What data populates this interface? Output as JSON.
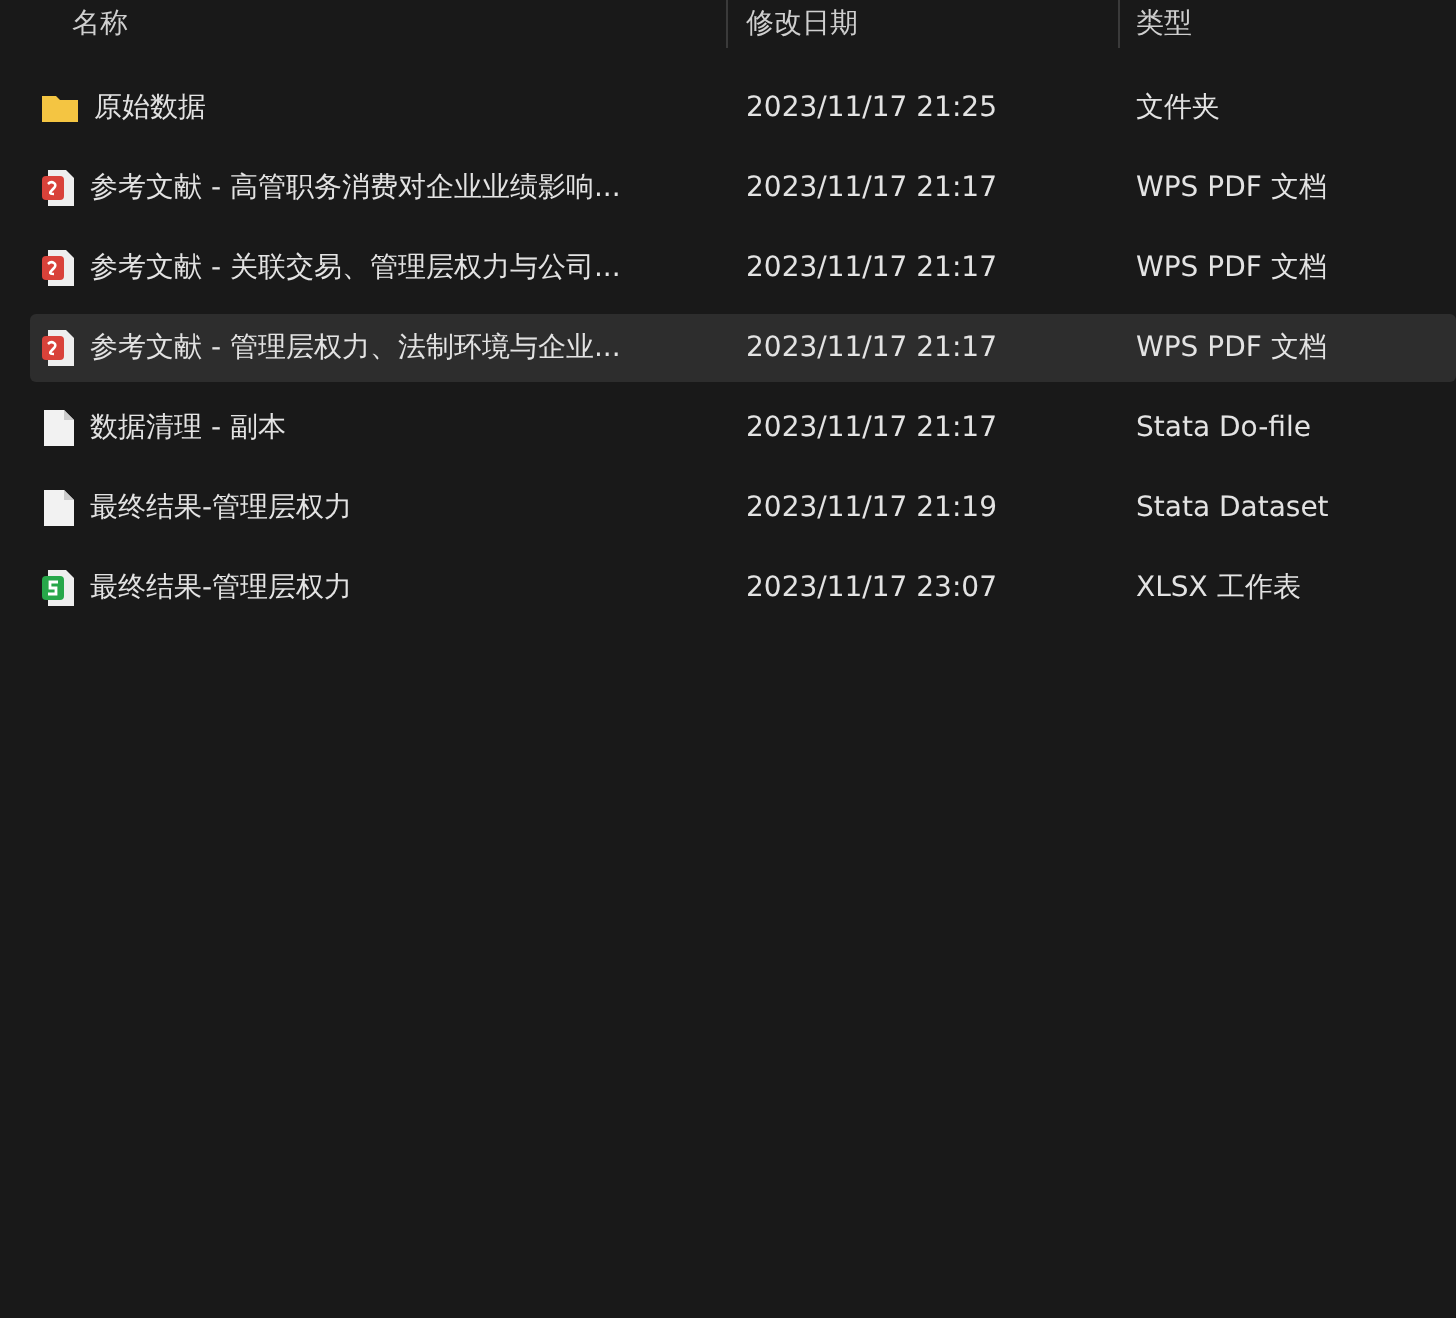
{
  "columns": [
    "名称",
    "修改日期",
    "类型"
  ],
  "rows": [
    {
      "kind": "folder",
      "name": "原始数据",
      "date": "2023/11/17 21:25",
      "type": "文件夹",
      "selected": false
    },
    {
      "kind": "pdf",
      "name": "参考文献 - 高管职务消费对企业业绩影响...",
      "date": "2023/11/17 21:17",
      "type": "WPS PDF 文档",
      "selected": false
    },
    {
      "kind": "pdf",
      "name": "参考文献 - 关联交易、管理层权力与公司...",
      "date": "2023/11/17 21:17",
      "type": "WPS PDF 文档",
      "selected": false
    },
    {
      "kind": "pdf",
      "name": "参考文献 - 管理层权力、法制环境与企业...",
      "date": "2023/11/17 21:17",
      "type": "WPS PDF 文档",
      "selected": true
    },
    {
      "kind": "file",
      "name": "数据清理 - 副本",
      "date": "2023/11/17 21:17",
      "type": "Stata Do-file",
      "selected": false
    },
    {
      "kind": "file",
      "name": "最终结果-管理层权力",
      "date": "2023/11/17 21:19",
      "type": "Stata Dataset",
      "selected": false
    },
    {
      "kind": "sheet",
      "name": "最终结果-管理层权力",
      "date": "2023/11/17 23:07",
      "type": "XLSX 工作表",
      "selected": false
    }
  ]
}
